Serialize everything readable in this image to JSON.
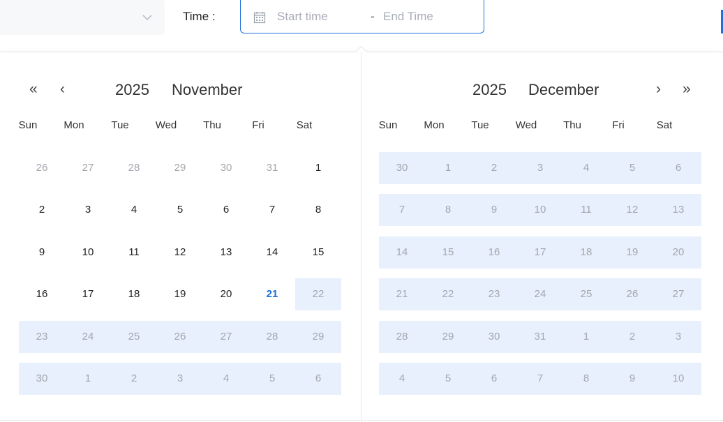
{
  "filter": {
    "time_label": "Time :",
    "start_placeholder": "Start time",
    "separator": "-",
    "end_placeholder": "End Time"
  },
  "calendars": [
    {
      "year": "2025",
      "month": "November",
      "weekdays": [
        "Sun",
        "Mon",
        "Tue",
        "Wed",
        "Thu",
        "Fri",
        "Sat"
      ],
      "nav_prev_year": "«",
      "nav_prev_month": "‹",
      "weeks": [
        [
          [
            "26",
            "out"
          ],
          [
            "27",
            "out"
          ],
          [
            "28",
            "out"
          ],
          [
            "29",
            "out"
          ],
          [
            "30",
            "out"
          ],
          [
            "31",
            "out"
          ],
          [
            "1",
            "cur"
          ]
        ],
        [
          [
            "2",
            "cur"
          ],
          [
            "3",
            "cur"
          ],
          [
            "4",
            "cur"
          ],
          [
            "5",
            "cur"
          ],
          [
            "6",
            "cur"
          ],
          [
            "7",
            "cur"
          ],
          [
            "8",
            "cur"
          ]
        ],
        [
          [
            "9",
            "cur"
          ],
          [
            "10",
            "cur"
          ],
          [
            "11",
            "cur"
          ],
          [
            "12",
            "cur"
          ],
          [
            "13",
            "cur"
          ],
          [
            "14",
            "cur"
          ],
          [
            "15",
            "cur"
          ]
        ],
        [
          [
            "16",
            "cur"
          ],
          [
            "17",
            "cur"
          ],
          [
            "18",
            "cur"
          ],
          [
            "19",
            "cur"
          ],
          [
            "20",
            "cur"
          ],
          [
            "21",
            "today"
          ],
          [
            "22",
            "out"
          ]
        ],
        [
          [
            "23",
            "out"
          ],
          [
            "24",
            "out"
          ],
          [
            "25",
            "out"
          ],
          [
            "26",
            "out"
          ],
          [
            "27",
            "out"
          ],
          [
            "28",
            "out"
          ],
          [
            "29",
            "out"
          ]
        ],
        [
          [
            "30",
            "out"
          ],
          [
            "1",
            "out"
          ],
          [
            "2",
            "out"
          ],
          [
            "3",
            "out"
          ],
          [
            "4",
            "out"
          ],
          [
            "5",
            "out"
          ],
          [
            "6",
            "out"
          ]
        ]
      ],
      "highlight": [
        [
          3,
          6,
          6
        ],
        [
          4,
          0,
          6
        ],
        [
          5,
          0,
          6
        ]
      ]
    },
    {
      "year": "2025",
      "month": "December",
      "weekdays": [
        "Sun",
        "Mon",
        "Tue",
        "Wed",
        "Thu",
        "Fri",
        "Sat"
      ],
      "nav_next_month": "›",
      "nav_next_year": "»",
      "weeks": [
        [
          [
            "30",
            "out"
          ],
          [
            "1",
            "out"
          ],
          [
            "2",
            "out"
          ],
          [
            "3",
            "out"
          ],
          [
            "4",
            "out"
          ],
          [
            "5",
            "out"
          ],
          [
            "6",
            "out"
          ]
        ],
        [
          [
            "7",
            "out"
          ],
          [
            "8",
            "out"
          ],
          [
            "9",
            "out"
          ],
          [
            "10",
            "out"
          ],
          [
            "11",
            "out"
          ],
          [
            "12",
            "out"
          ],
          [
            "13",
            "out"
          ]
        ],
        [
          [
            "14",
            "out"
          ],
          [
            "15",
            "out"
          ],
          [
            "16",
            "out"
          ],
          [
            "17",
            "out"
          ],
          [
            "18",
            "out"
          ],
          [
            "19",
            "out"
          ],
          [
            "20",
            "out"
          ]
        ],
        [
          [
            "21",
            "out"
          ],
          [
            "22",
            "out"
          ],
          [
            "23",
            "out"
          ],
          [
            "24",
            "out"
          ],
          [
            "25",
            "out"
          ],
          [
            "26",
            "out"
          ],
          [
            "27",
            "out"
          ]
        ],
        [
          [
            "28",
            "out"
          ],
          [
            "29",
            "out"
          ],
          [
            "30",
            "out"
          ],
          [
            "31",
            "out"
          ],
          [
            "1",
            "out"
          ],
          [
            "2",
            "out"
          ],
          [
            "3",
            "out"
          ]
        ],
        [
          [
            "4",
            "out"
          ],
          [
            "5",
            "out"
          ],
          [
            "6",
            "out"
          ],
          [
            "7",
            "out"
          ],
          [
            "8",
            "out"
          ],
          [
            "9",
            "out"
          ],
          [
            "10",
            "out"
          ]
        ]
      ],
      "highlight": [
        [
          0,
          0,
          6
        ],
        [
          1,
          0,
          6
        ],
        [
          2,
          0,
          6
        ],
        [
          3,
          0,
          6
        ],
        [
          4,
          0,
          6
        ],
        [
          5,
          0,
          6
        ]
      ]
    }
  ],
  "colors": {
    "accent": "#1f6fde",
    "range_bg": "#e8f0fd",
    "today": "#1a6fd8"
  }
}
